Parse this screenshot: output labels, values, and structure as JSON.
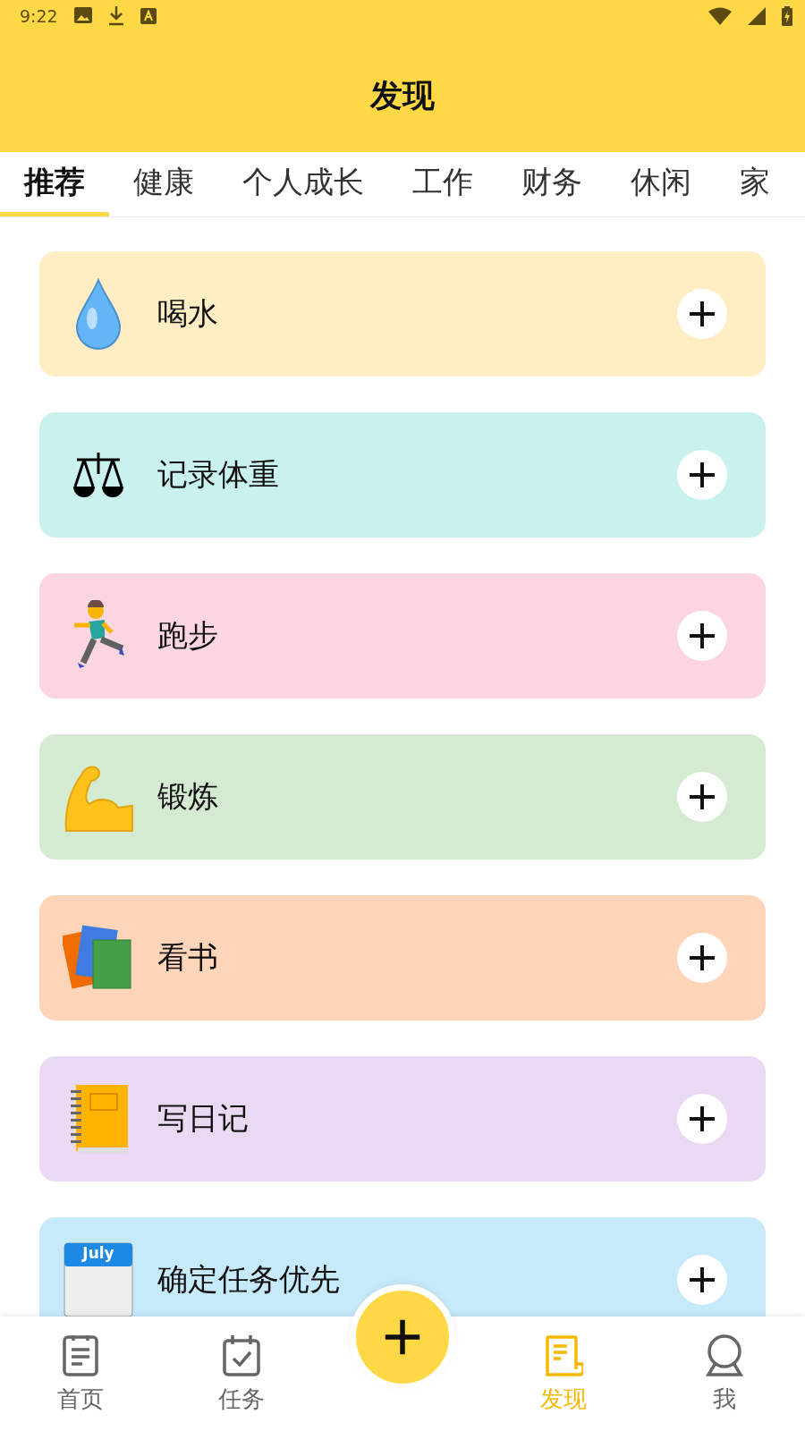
{
  "status_bar": {
    "time": "9:22"
  },
  "header": {
    "title": "发现"
  },
  "tabs": [
    {
      "label": "推荐",
      "selected": true
    },
    {
      "label": "健康",
      "selected": false
    },
    {
      "label": "个人成长",
      "selected": false
    },
    {
      "label": "工作",
      "selected": false
    },
    {
      "label": "财务",
      "selected": false
    },
    {
      "label": "休闲",
      "selected": false
    },
    {
      "label": "家",
      "selected": false
    }
  ],
  "cards": [
    {
      "kind": "drop",
      "title": "喝水",
      "color": "#ffedc4"
    },
    {
      "kind": "scale",
      "title": "记录体重",
      "color": "#c9f1ee"
    },
    {
      "kind": "runner",
      "title": "跑步",
      "color": "#fbd6e2"
    },
    {
      "kind": "muscle",
      "title": "锻炼",
      "color": "#d4ead1"
    },
    {
      "kind": "books",
      "title": "看书",
      "color": "#ffd5b9"
    },
    {
      "kind": "notebook",
      "title": "写日记",
      "color": "#ead9f2"
    },
    {
      "kind": "calendar",
      "title": "确定任务优先",
      "color": "#c7eafb",
      "icon_text": "July"
    }
  ],
  "nav": [
    {
      "kind": "home",
      "label": "首页",
      "selected": false
    },
    {
      "kind": "tasks",
      "label": "任务",
      "selected": false
    },
    {
      "kind": "fab"
    },
    {
      "kind": "discover",
      "label": "发现",
      "selected": true
    },
    {
      "kind": "me",
      "label": "我",
      "selected": false
    }
  ]
}
